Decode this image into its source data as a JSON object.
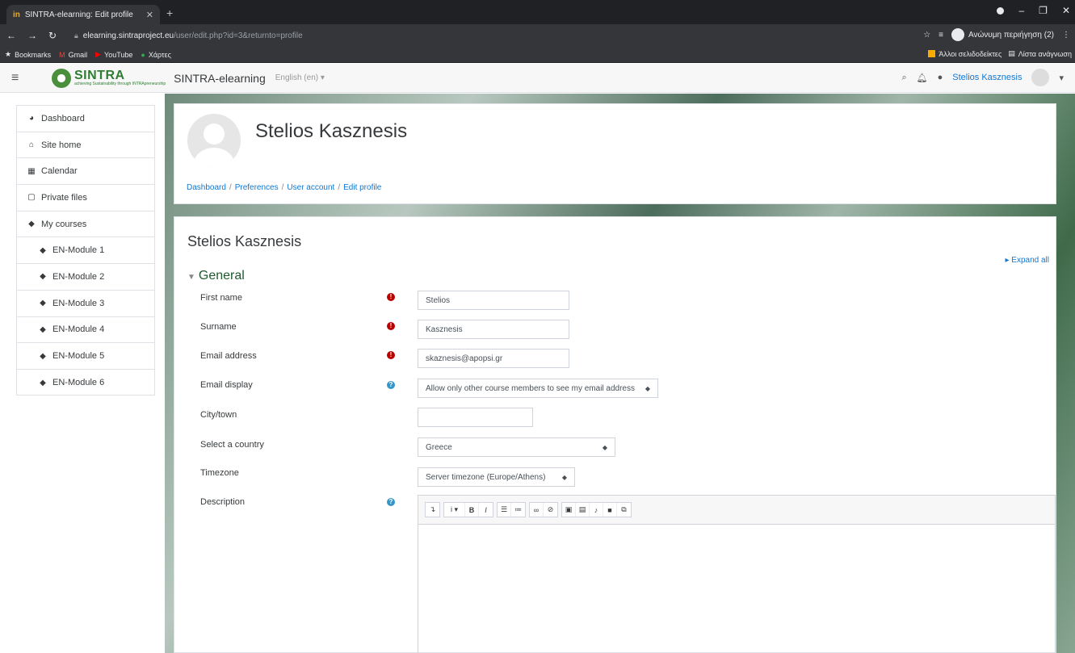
{
  "browser": {
    "tab_title": "SINTRA-elearning: Edit profile",
    "tab_favicon": "in",
    "url_host": "elearning.sintraproject.eu",
    "url_path": "/user/edit.php?id=3&returnto=profile",
    "incognito_label": "Ανώνυμη περιήγηση (2)",
    "bookmarks": [
      {
        "label": "Bookmarks",
        "icon": "star-icon"
      },
      {
        "label": "Gmail",
        "icon": "gmail-icon"
      },
      {
        "label": "YouTube",
        "icon": "youtube-icon"
      },
      {
        "label": "Χάρτες",
        "icon": "maps-icon"
      }
    ],
    "other_bookmarks": "Άλλοι σελιδοδείκτες",
    "reading_list": "Λίστα ανάγνωση"
  },
  "navbar": {
    "brand": "SINTRA",
    "brand_tagline": "achieving Sustainability through INTRApreneurship",
    "site_name": "SINTRA-elearning",
    "language": "English (en) ▾",
    "user_name": "Stelios Kasznesis"
  },
  "sidebar": {
    "items": [
      {
        "label": "Dashboard",
        "icon": "dashboard-icon",
        "glyph": "◕"
      },
      {
        "label": "Site home",
        "icon": "home-icon",
        "glyph": "⌂"
      },
      {
        "label": "Calendar",
        "icon": "calendar-icon",
        "glyph": "▦"
      },
      {
        "label": "Private files",
        "icon": "file-icon",
        "glyph": "▢"
      },
      {
        "label": "My courses",
        "icon": "graduation-cap-icon",
        "glyph": "◆"
      },
      {
        "label": "EN-Module 1",
        "icon": "graduation-cap-icon",
        "glyph": "◆"
      },
      {
        "label": "EN-Module 2",
        "icon": "graduation-cap-icon",
        "glyph": "◆"
      },
      {
        "label": "EN-Module 3",
        "icon": "graduation-cap-icon",
        "glyph": "◆"
      },
      {
        "label": "EN-Module 4",
        "icon": "graduation-cap-icon",
        "glyph": "◆"
      },
      {
        "label": "EN-Module 5",
        "icon": "graduation-cap-icon",
        "glyph": "◆"
      },
      {
        "label": "EN-Module 6",
        "icon": "graduation-cap-icon",
        "glyph": "◆"
      }
    ]
  },
  "header": {
    "name": "Stelios Kasznesis",
    "breadcrumb": [
      "Dashboard",
      "Preferences",
      "User account",
      "Edit profile"
    ]
  },
  "main": {
    "title": "Stelios Kasznesis",
    "expand_all": "▸ Expand all",
    "section": "General",
    "fields": {
      "first_name": {
        "label": "First name",
        "value": "Stelios"
      },
      "surname": {
        "label": "Surname",
        "value": "Kasznesis"
      },
      "email": {
        "label": "Email address",
        "value": "skaznesis@apopsi.gr"
      },
      "email_display": {
        "label": "Email display",
        "value": "Allow only other course members to see my email address"
      },
      "city": {
        "label": "City/town",
        "value": ""
      },
      "country": {
        "label": "Select a country",
        "value": "Greece"
      },
      "timezone": {
        "label": "Timezone",
        "value": "Server timezone (Europe/Athens)"
      },
      "description": {
        "label": "Description"
      }
    }
  },
  "colors": {
    "link": "#1177d1",
    "required": "#bb0000",
    "help": "#3596c7",
    "section_heading": "#1e5b2e"
  }
}
